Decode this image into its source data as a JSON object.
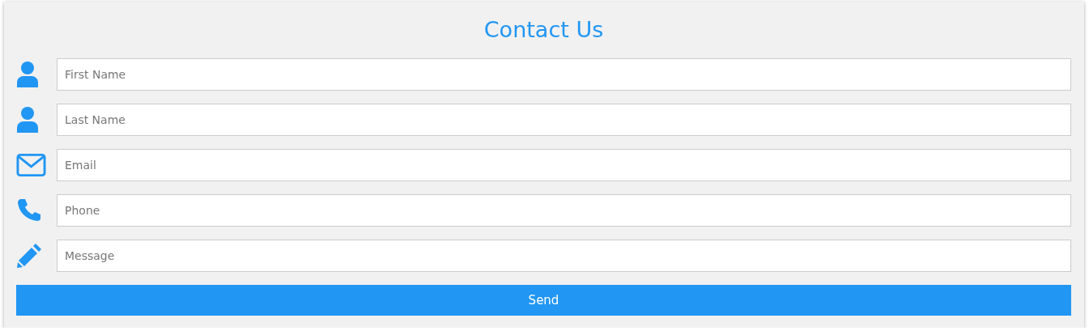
{
  "form": {
    "title": "Contact Us",
    "fields": [
      {
        "kind": "name",
        "placeholder": "First Name"
      },
      {
        "kind": "name",
        "placeholder": "Last Name"
      },
      {
        "kind": "email",
        "placeholder": "Email"
      },
      {
        "kind": "phone",
        "placeholder": "Phone"
      },
      {
        "kind": "message",
        "placeholder": "Message"
      }
    ],
    "button": "Send"
  }
}
